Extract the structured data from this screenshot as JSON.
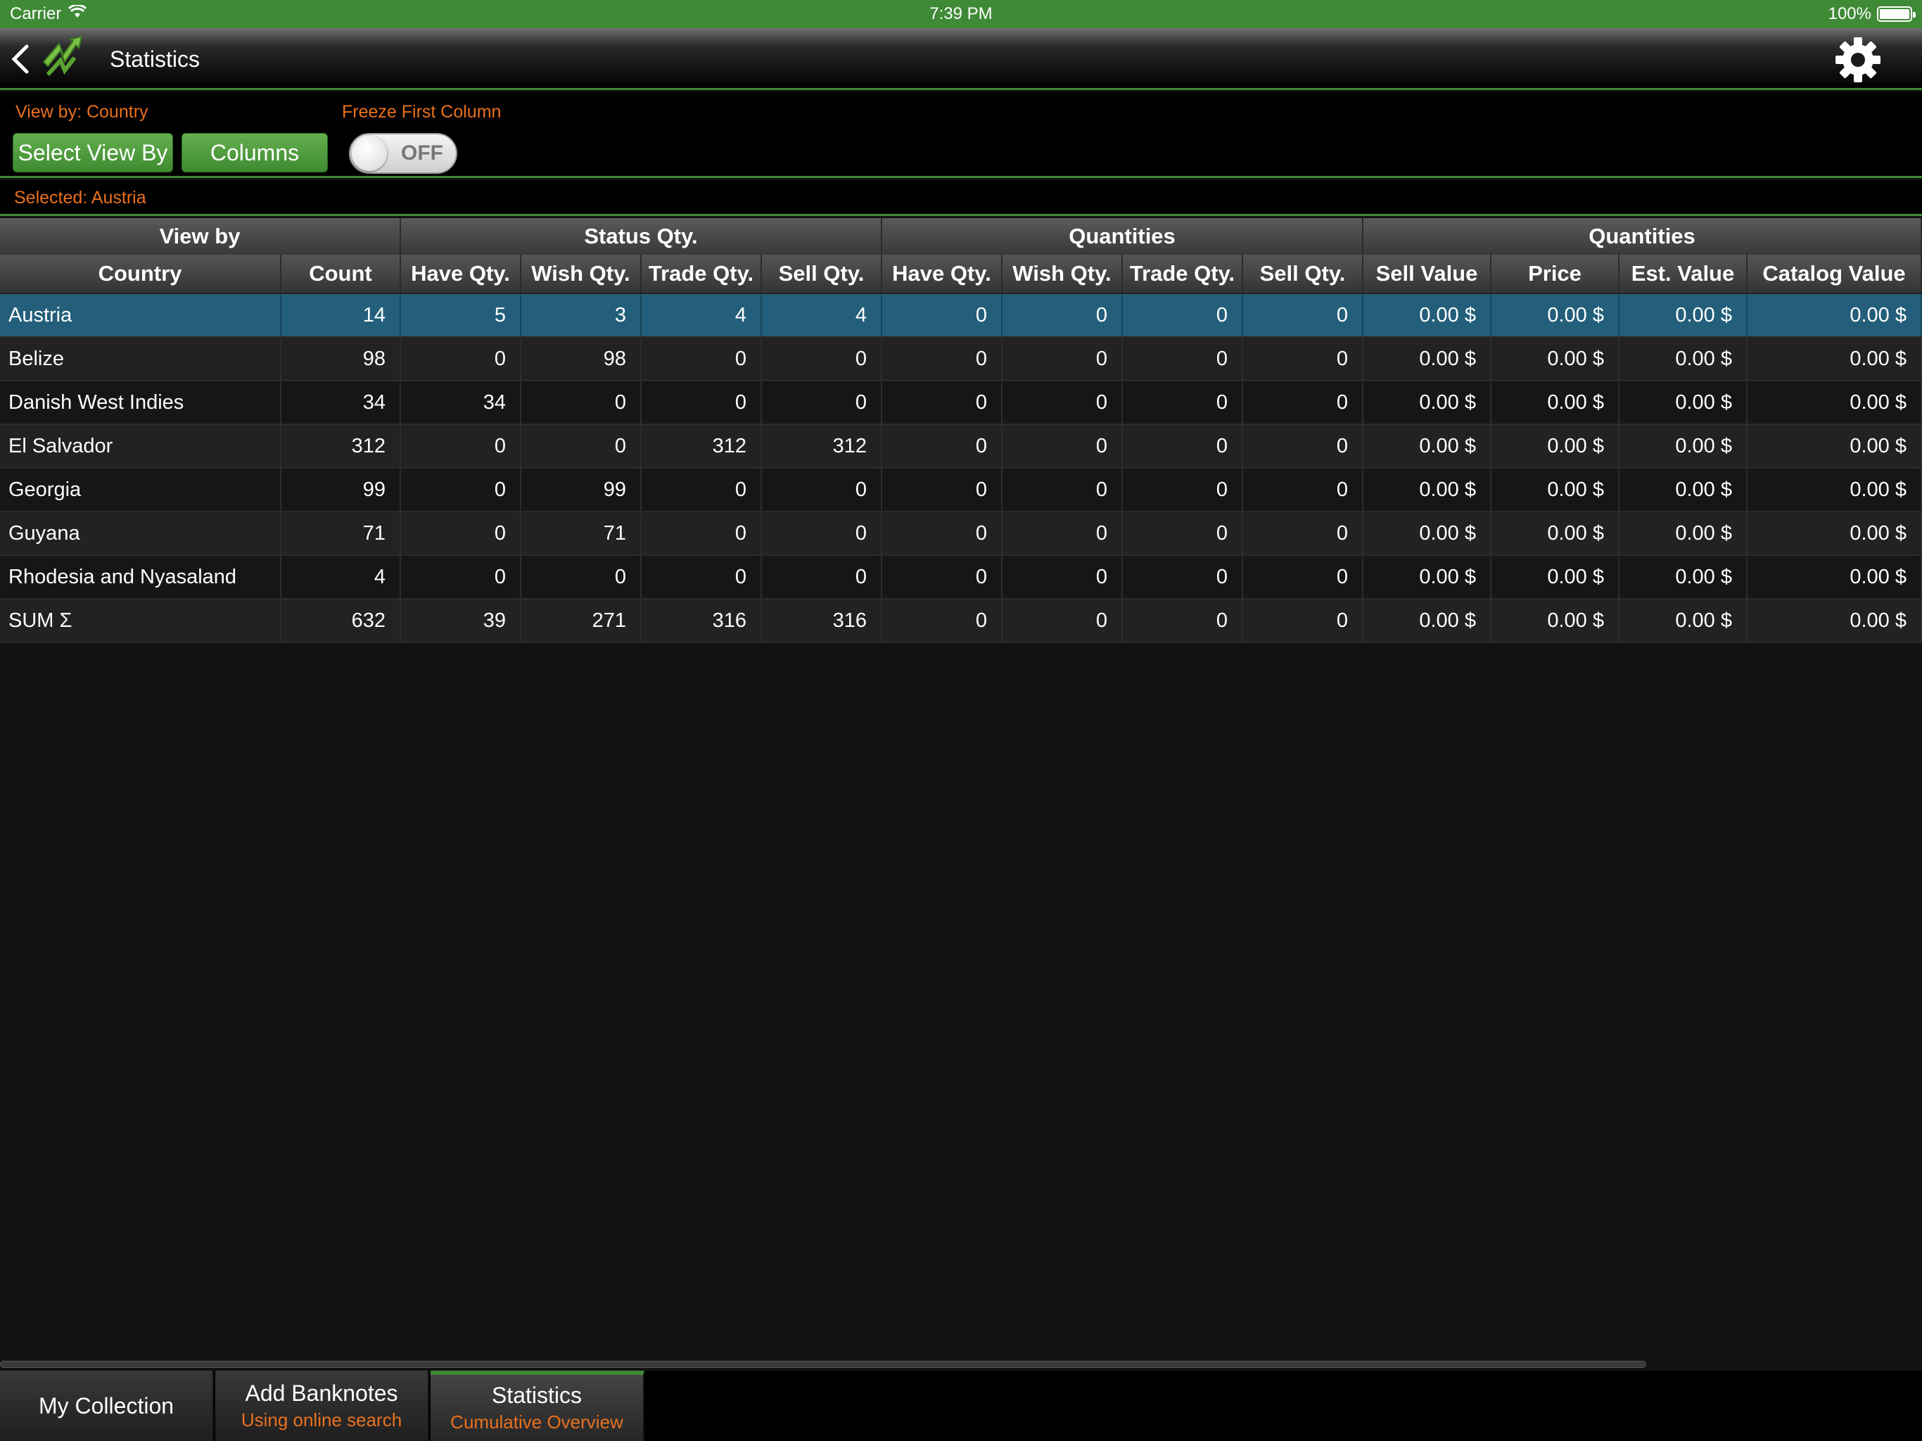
{
  "status_bar": {
    "carrier": "Carrier",
    "time": "7:39 PM",
    "battery": "100%"
  },
  "nav": {
    "title": "Statistics"
  },
  "controls": {
    "view_by_label": "View by: Country",
    "select_view_by": "Select View By",
    "columns": "Columns",
    "freeze_label": "Freeze First Column",
    "freeze_state": "OFF",
    "selected_label": "Selected: Austria"
  },
  "table": {
    "groups": [
      "View by",
      "Status Qty.",
      "Quantities",
      "Quantities"
    ],
    "columns": [
      "Country",
      "Count",
      "Have Qty.",
      "Wish Qty.",
      "Trade Qty.",
      "Sell Qty.",
      "Have Qty.",
      "Wish Qty.",
      "Trade Qty.",
      "Sell Qty.",
      "Sell Value",
      "Price",
      "Est. Value",
      "Catalog Value"
    ],
    "rows": [
      [
        "Austria",
        "14",
        "5",
        "3",
        "4",
        "4",
        "0",
        "0",
        "0",
        "0",
        "0.00 $",
        "0.00 $",
        "0.00 $",
        "0.00 $"
      ],
      [
        "Belize",
        "98",
        "0",
        "98",
        "0",
        "0",
        "0",
        "0",
        "0",
        "0",
        "0.00 $",
        "0.00 $",
        "0.00 $",
        "0.00 $"
      ],
      [
        "Danish West Indies",
        "34",
        "34",
        "0",
        "0",
        "0",
        "0",
        "0",
        "0",
        "0",
        "0.00 $",
        "0.00 $",
        "0.00 $",
        "0.00 $"
      ],
      [
        "El Salvador",
        "312",
        "0",
        "0",
        "312",
        "312",
        "0",
        "0",
        "0",
        "0",
        "0.00 $",
        "0.00 $",
        "0.00 $",
        "0.00 $"
      ],
      [
        "Georgia",
        "99",
        "0",
        "99",
        "0",
        "0",
        "0",
        "0",
        "0",
        "0",
        "0.00 $",
        "0.00 $",
        "0.00 $",
        "0.00 $"
      ],
      [
        "Guyana",
        "71",
        "0",
        "71",
        "0",
        "0",
        "0",
        "0",
        "0",
        "0",
        "0.00 $",
        "0.00 $",
        "0.00 $",
        "0.00 $"
      ],
      [
        "Rhodesia and Nyasaland",
        "4",
        "0",
        "0",
        "0",
        "0",
        "0",
        "0",
        "0",
        "0",
        "0.00 $",
        "0.00 $",
        "0.00 $",
        "0.00 $"
      ],
      [
        "SUM Σ",
        "632",
        "39",
        "271",
        "316",
        "316",
        "0",
        "0",
        "0",
        "0",
        "0.00 $",
        "0.00 $",
        "0.00 $",
        "0.00 $"
      ]
    ]
  },
  "tabs": [
    {
      "title": "My Collection",
      "subtitle": ""
    },
    {
      "title": "Add Banknotes",
      "subtitle": "Using online search"
    },
    {
      "title": "Statistics",
      "subtitle": "Cumulative Overview"
    }
  ],
  "colors": {
    "accent_green": "#3f8a36",
    "orange": "#e8711f",
    "selected_row": "#235f7a"
  }
}
